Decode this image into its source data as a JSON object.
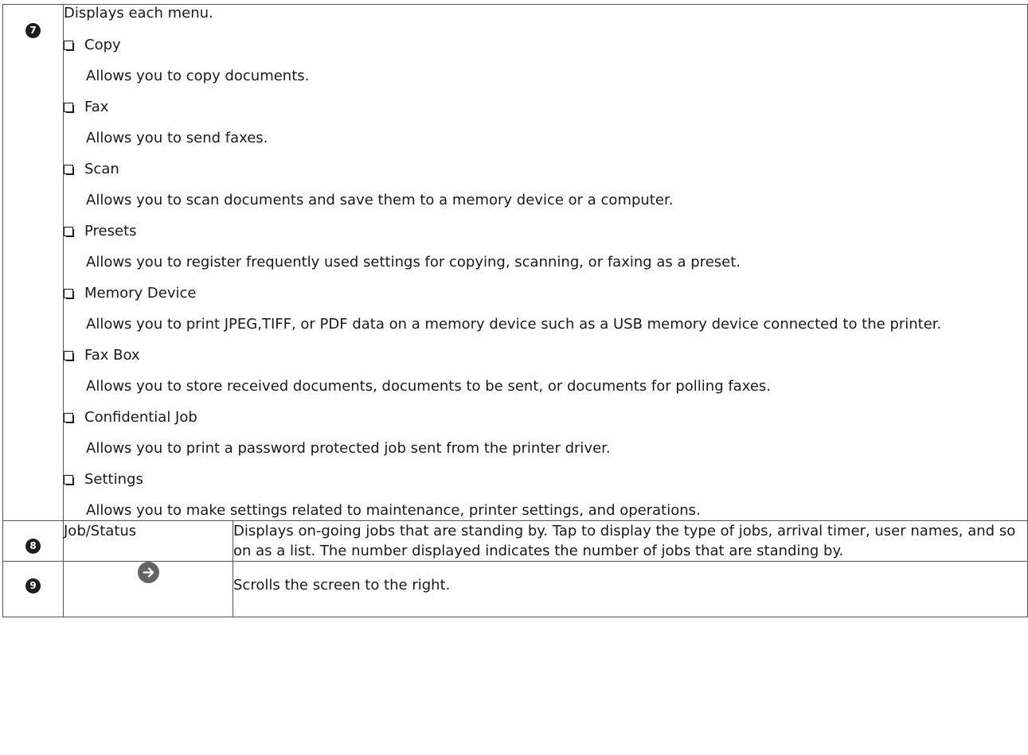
{
  "rows": [
    {
      "number": "7",
      "intro": "Displays each menu.",
      "items": [
        {
          "name": "Copy",
          "desc": "Allows you to copy documents."
        },
        {
          "name": "Fax",
          "desc": "Allows you to send faxes."
        },
        {
          "name": "Scan",
          "desc": "Allows you to scan documents and save them to a memory device or a computer."
        },
        {
          "name": "Presets",
          "desc": "Allows you to register frequently used settings for copying, scanning, or faxing as a preset."
        },
        {
          "name": "Memory Device",
          "desc": "Allows you to print JPEG,TIFF, or PDF data on a memory device such as a USB memory device connected to the printer."
        },
        {
          "name": "Fax Box",
          "desc": "Allows you to store received documents, documents to be sent, or documents for polling faxes."
        },
        {
          "name": "Confidential Job",
          "desc": "Allows you to print a password protected job sent from the printer driver."
        },
        {
          "name": "Settings",
          "desc": "Allows you to make settings related to maintenance, printer settings, and operations."
        }
      ]
    },
    {
      "number": "8",
      "label": "Job/Status",
      "desc": "Displays on-going jobs that are standing by. Tap to display the type of jobs, arrival timer, user names, and so on as a list. The number displayed indicates the number of jobs that are standing by."
    },
    {
      "number": "9",
      "icon": "arrow-right-circle-icon",
      "desc": "Scrolls the screen to the right."
    }
  ]
}
